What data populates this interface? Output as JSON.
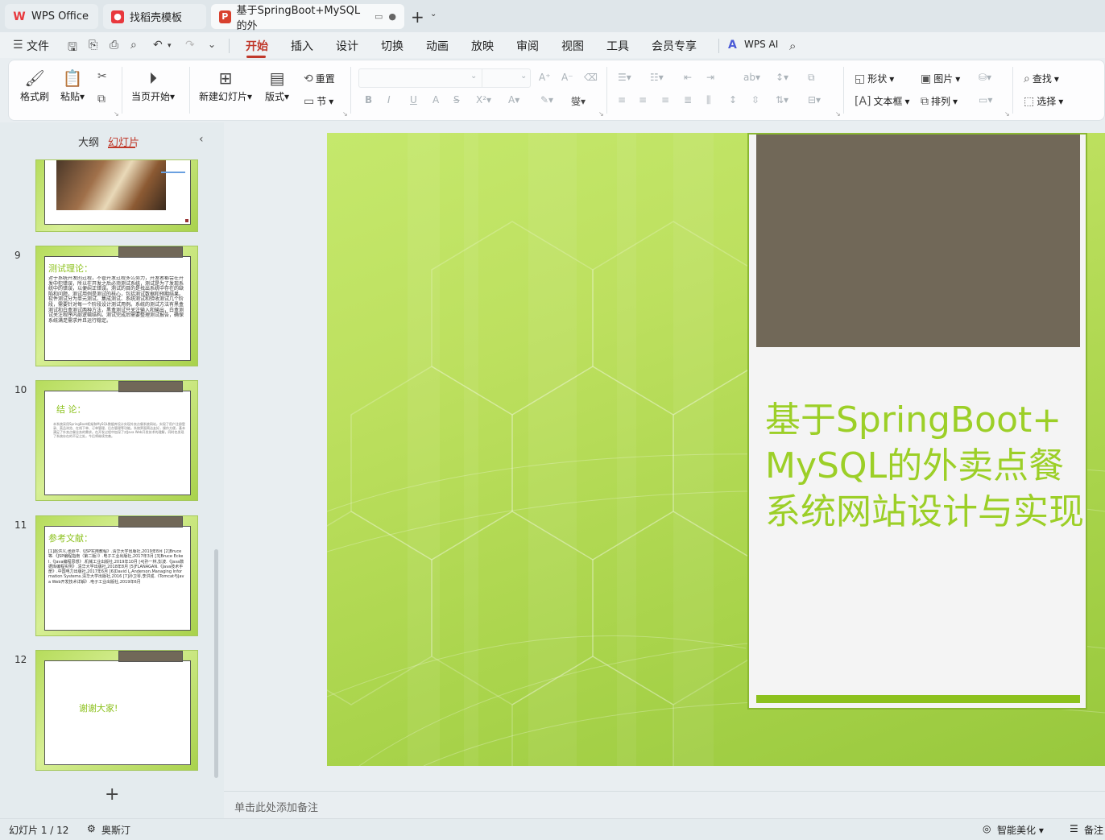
{
  "tabs": [
    {
      "label": "WPS Office",
      "icon": "wps-logo-icon"
    },
    {
      "label": "找稻壳模板",
      "icon": "docer-icon"
    },
    {
      "label": "基于SpringBoot+MySQL的外",
      "icon": "ppt-file-icon",
      "active": true
    }
  ],
  "menu": {
    "file_label": "文件",
    "items": [
      "开始",
      "插入",
      "设计",
      "切换",
      "动画",
      "放映",
      "审阅",
      "视图",
      "工具",
      "会员专享"
    ],
    "active": "开始",
    "ai_label": "WPS AI"
  },
  "ribbon": {
    "format_painter": "格式刷",
    "paste": "粘贴",
    "from_current": "当页开始",
    "new_slide": "新建幻灯片",
    "layout": "版式",
    "reset": "重置",
    "section": "节",
    "shape": "形状",
    "picture": "图片",
    "textbox": "文本框",
    "arrange": "排列",
    "find": "查找",
    "select": "选择"
  },
  "panel": {
    "tab_outline": "大纲",
    "tab_slides": "幻灯片",
    "active_tab": "幻灯片"
  },
  "thumbnails": [
    {
      "number": "9",
      "title": "测试理论：",
      "text": "对于系统开发的过程，不管开发过程多么努力，开发者都会在开发中犯错误，所以在开发之后必须测试系统，测试是为了发现系统中的错误，以便纠正错误。测试的目的是找出系统中存在的缺陷和问题，测试用例是测试的核心，包括测试数据和预期结果。软件测试分为单元测试、集成测试、系统测试和验收测试几个阶段，需要针对每一个阶段设计测试用例。系统的测试方法有黑盒测试和白盒测试两种方法，黑盒测试只关注输入和输出，白盒测试关注程序内部逻辑结构。测试完成后需要整理测试报告，确保系统满足需求并且运行稳定。"
    },
    {
      "number": "10",
      "title": "结 论：",
      "text": "本系统采用SpringBoot框架和MySQL数据库设计实现外卖点餐系统网站，实现了用户注册登录、菜品浏览、在线下单、订单管理、后台管理等功能。系统界面简洁友好，操作方便，基本满足了外卖点餐业务的需求。在开发过程中加深了对Java Web开发技术的理解，同时也发现了系统存在的不足之处，今后将继续完善。"
    },
    {
      "number": "11",
      "title": "参考文献：",
      "text": "[1]赵洪义,张跃平.《JSP实用教程》.清华大学出版社,2019年8月 [2]Bruce等.《JSP编程指南（第二版）》.电子工业出版社,2017年3月 [3]Bruce Eckel.《Java编程思想》.机械工业出版社,2019年10月 [4]孙一林,彭波.《Java数据库编程实例》.清华大学出版社,2018年8月 [5]FLANAGAN.《Java技术手册》.中国电力出版社,2017年6月 [6]David L.Anderson.Managing Information Systems.清华大学出版社,2016 [7]孙卫琴,李洪成.《Tomcat与Java Web开发技术详解》.电子工业出版社,2019年6月"
    },
    {
      "number": "12",
      "title": "谢谢大家!",
      "text": ""
    }
  ],
  "slide": {
    "title": "基于SpringBoot+MySQL的外卖点餐系统网站设计与实现"
  },
  "notes_placeholder": "单击此处添加备注",
  "status": {
    "slide_counter": "幻灯片 1 / 12",
    "theme": "奥斯汀",
    "smart_beautify": "智能美化",
    "notes": "备注"
  },
  "colors": {
    "accent": "#c0392b",
    "slide_green": "#b5dc5a",
    "title_green": "#9ccf27",
    "photo_brown": "#716858"
  }
}
